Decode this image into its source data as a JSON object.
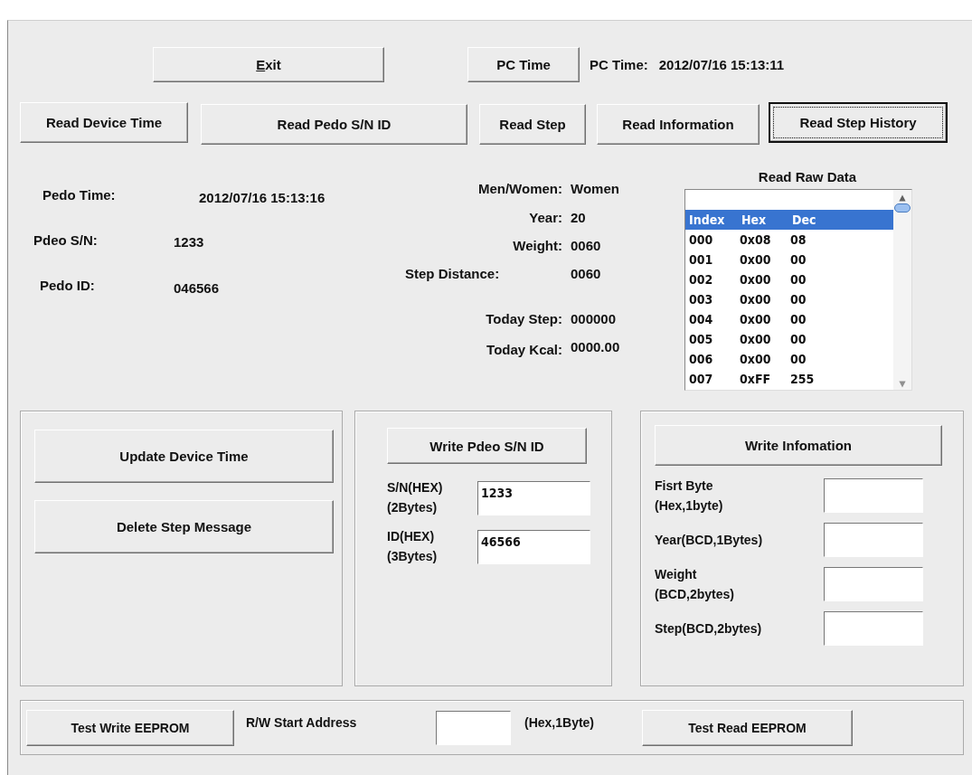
{
  "toolbar": {
    "exit_button": "Exit",
    "pc_time_button": "PC Time",
    "pc_time_label": "PC Time:",
    "pc_time_value": "2012/07/16 15:13:11"
  },
  "read_buttons": [
    {
      "label": "Read Device Time",
      "focused": false
    },
    {
      "label": "Read Pedo S/N ID",
      "focused": false
    },
    {
      "label": "Read Step",
      "focused": false
    },
    {
      "label": "Read Information",
      "focused": false
    },
    {
      "label": "Read Step History",
      "focused": true
    }
  ],
  "device_info": [
    {
      "label": "Pedo Time:",
      "value": "2012/07/16 15:13:16"
    },
    {
      "label": "Pdeo S/N:",
      "value": "1233"
    },
    {
      "label": "Pedo ID:",
      "value": "046566"
    }
  ],
  "profile_info": [
    {
      "label": "Men/Women:",
      "value": "Women"
    },
    {
      "label": "Year:",
      "value": "20"
    },
    {
      "label": "Weight:",
      "value": "0060"
    },
    {
      "label": "Step Distance:",
      "value": "0060"
    },
    {
      "label": "Today Step:",
      "value": "000000"
    },
    {
      "label": "Today Kcal:",
      "value": "0000.00"
    }
  ],
  "raw_data": {
    "title": "Read Raw Data",
    "rows": [
      {
        "cells": [
          "Index",
          "Hex",
          "Dec"
        ],
        "selected": true
      },
      {
        "cells": [
          "000",
          "0x08",
          "08"
        ],
        "selected": false
      },
      {
        "cells": [
          "001",
          "0x00",
          "00"
        ],
        "selected": false
      },
      {
        "cells": [
          "002",
          "0x00",
          "00"
        ],
        "selected": false
      },
      {
        "cells": [
          "003",
          "0x00",
          "00"
        ],
        "selected": false
      },
      {
        "cells": [
          "004",
          "0x00",
          "00"
        ],
        "selected": false
      },
      {
        "cells": [
          "005",
          "0x00",
          "00"
        ],
        "selected": false
      },
      {
        "cells": [
          "006",
          "0x00",
          "00"
        ],
        "selected": false
      },
      {
        "cells": [
          "007",
          "0xFF",
          "255"
        ],
        "selected": false
      }
    ]
  },
  "time_group": {
    "buttons": [
      "Update Device Time",
      "Delete Step Message"
    ]
  },
  "sn_group": {
    "button": "Write Pdeo S/N ID",
    "fields": [
      {
        "label_lines": [
          "S/N(HEX)",
          "(2Bytes)"
        ],
        "value": "1233"
      },
      {
        "label_lines": [
          "ID(HEX)",
          "(3Bytes)"
        ],
        "value": "46566"
      }
    ]
  },
  "info_group": {
    "button": "Write Infomation",
    "fields": [
      {
        "label_lines": [
          "Fisrt Byte",
          "(Hex,1byte)"
        ]
      },
      {
        "label_lines": [
          "Year(BCD,1Bytes)"
        ]
      },
      {
        "label_lines": [
          "Weight",
          "(BCD,2bytes)"
        ]
      },
      {
        "label_lines": [
          "Step(BCD,2bytes)"
        ]
      }
    ]
  },
  "eeprom": {
    "write_button": "Test Write EEPROM",
    "address_label": "R/W Start Address",
    "address_hint": "(Hex,1Byte)",
    "read_button": "Test Read EEPROM"
  }
}
